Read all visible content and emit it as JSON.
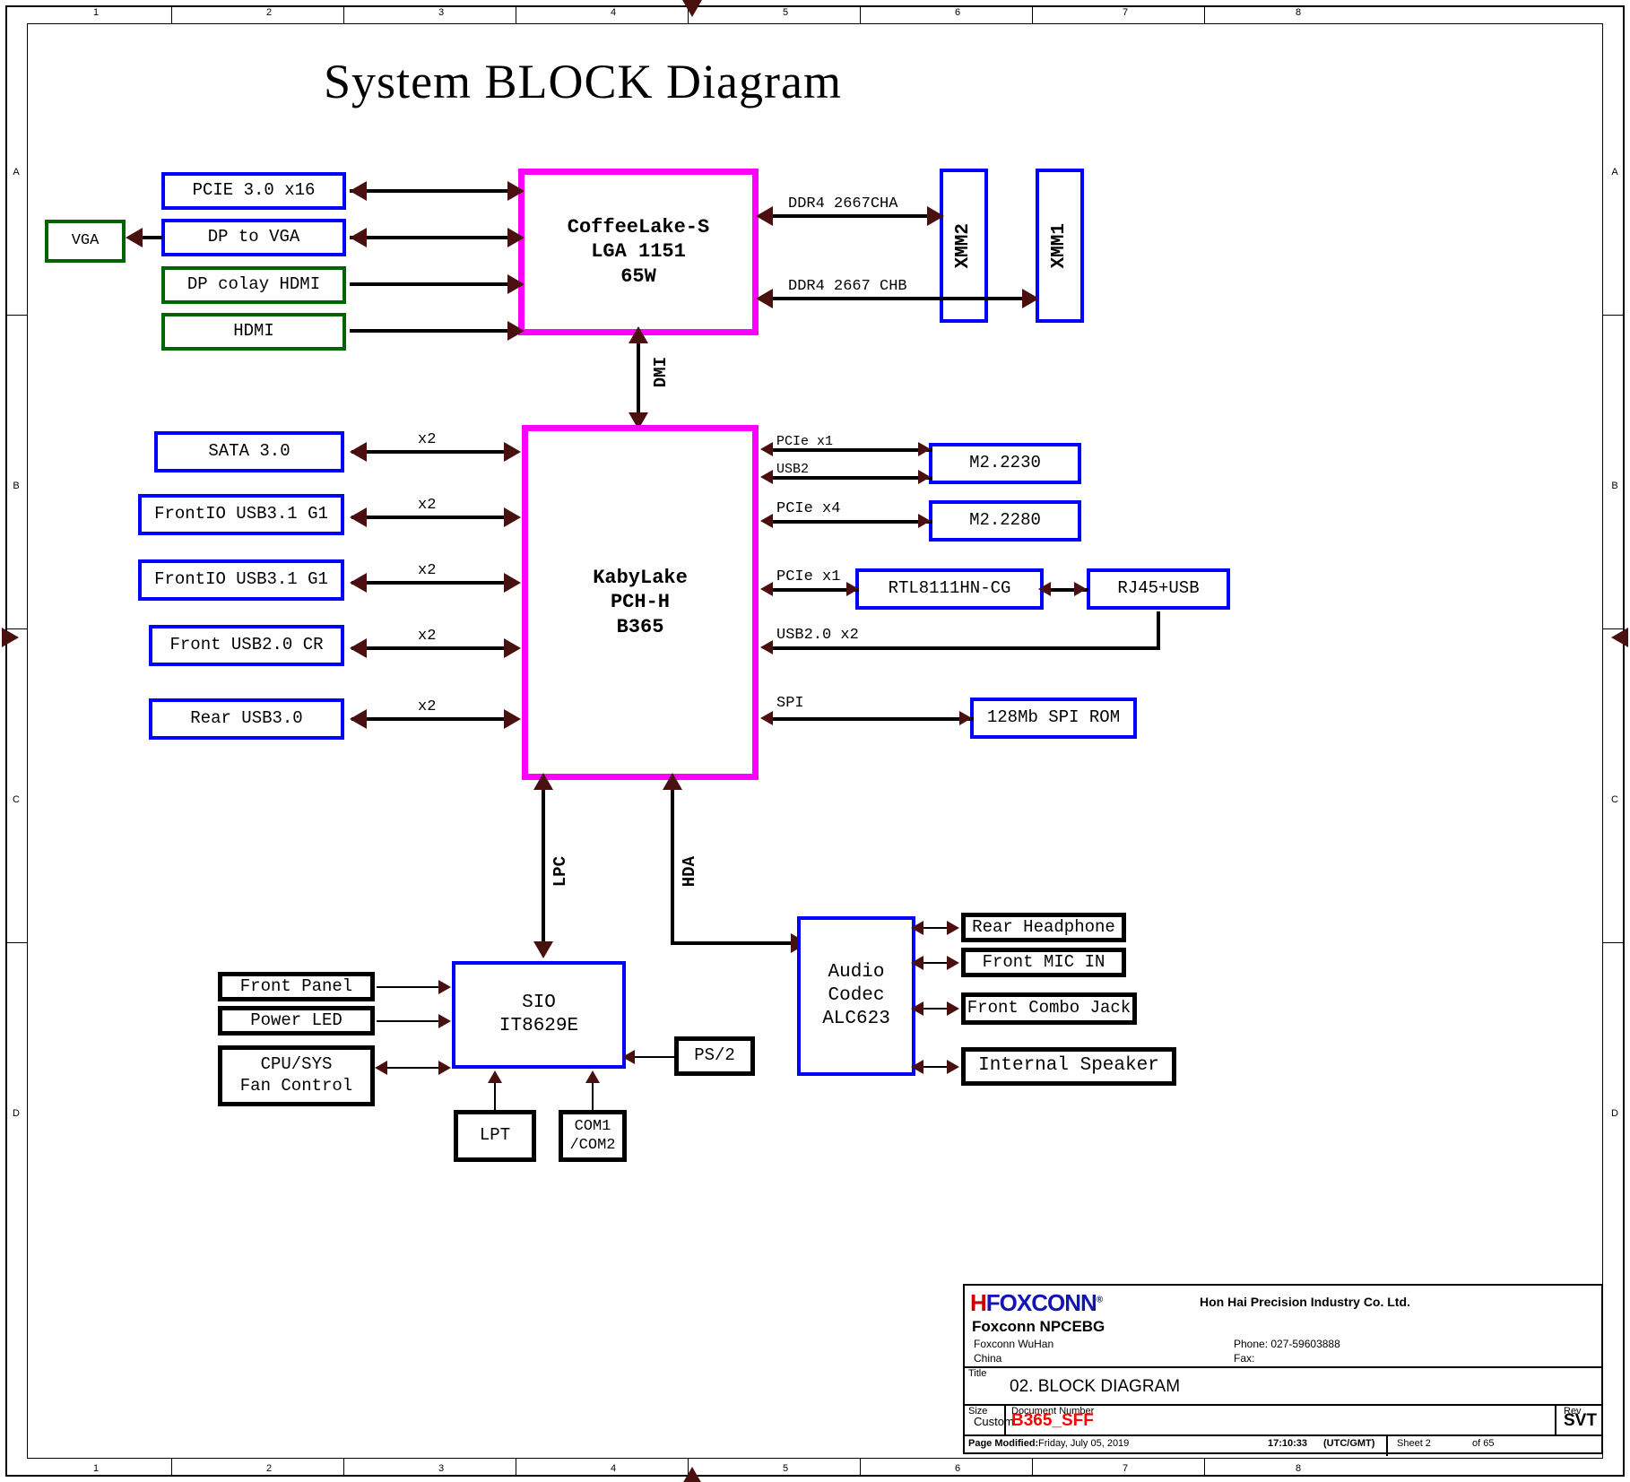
{
  "sheet": {
    "title": "System BLOCK Diagram",
    "zone_cols": [
      "1",
      "2",
      "3",
      "4",
      "5",
      "6",
      "7",
      "8"
    ],
    "zone_rows": [
      "A",
      "B",
      "C",
      "D"
    ]
  },
  "blocks": {
    "vga": {
      "label": "VGA"
    },
    "pcie_x16": {
      "label": "PCIE 3.0 x16"
    },
    "dp_to_vga": {
      "label": "DP to VGA"
    },
    "dp_colay_hdmi": {
      "label": "DP colay  HDMI"
    },
    "hdmi": {
      "label": "HDMI"
    },
    "cpu": {
      "label": "CoffeeLake-S\nLGA 1151\n65W"
    },
    "xmm2": {
      "label": "XMM2"
    },
    "xmm1": {
      "label": "XMM1"
    },
    "sata": {
      "label": "SATA 3.0"
    },
    "frontio_usb31_a": {
      "label": "FrontIO USB3.1 G1"
    },
    "frontio_usb31_b": {
      "label": "FrontIO USB3.1 G1"
    },
    "front_usb20_cr": {
      "label": "Front USB2.0 CR"
    },
    "rear_usb30": {
      "label": "Rear USB3.0"
    },
    "pch": {
      "label": "KabyLake\nPCH-H\nB365"
    },
    "m2_2230": {
      "label": "M2.2230"
    },
    "m2_2280": {
      "label": "M2.2280"
    },
    "rtl8111": {
      "label": "RTL8111HN-CG"
    },
    "rj45_usb": {
      "label": "RJ45+USB"
    },
    "spi_rom": {
      "label": "128Mb SPI ROM"
    },
    "front_panel": {
      "label": "Front Panel"
    },
    "power_led": {
      "label": "Power LED"
    },
    "fan_control": {
      "label": "CPU/SYS\nFan Control"
    },
    "sio": {
      "label": "SIO\nIT8629E"
    },
    "lpt": {
      "label": "LPT"
    },
    "com1_com2": {
      "label": "COM1\n/COM2"
    },
    "ps2": {
      "label": "PS/2"
    },
    "audio_codec": {
      "label": "Audio\nCodec\nALC623"
    },
    "rear_headphone": {
      "label": "Rear Headphone"
    },
    "front_mic_in": {
      "label": "Front MIC IN"
    },
    "front_combo": {
      "label": "Front Combo Jack"
    },
    "internal_spk": {
      "label": "Internal Speaker"
    }
  },
  "wire_labels": {
    "ddr4_cha": "DDR4 2667CHA",
    "ddr4_chb": "DDR4 2667 CHB",
    "dmi": "DMI",
    "sata_x2": "x2",
    "usb31a_x2": "x2",
    "usb31b_x2": "x2",
    "usb20_x2": "x2",
    "rear_x2": "x2",
    "pcie_x1_a": "PCIe x1",
    "usb2": "USB2",
    "pcie_x4": "PCIe x4",
    "pcie_x1_b": "PCIe x1",
    "usb20_2x": "USB2.0 x2",
    "spi": "SPI",
    "lpc": "LPC",
    "hda": "HDA"
  },
  "title_block": {
    "logo_h": "H",
    "logo_text": "FOXCONN",
    "logo_reg": "®",
    "company_unit": "Foxconn NPCEBG",
    "address_line1": "Foxconn WuHan",
    "address_line2": "China",
    "corporate_name": "Hon Hai Precision Industry Co. Ltd.",
    "phone": "Phone:  027-59603888",
    "fax": "Fax:",
    "title_label": "Title",
    "title_value": "02. BLOCK DIAGRAM",
    "size_label": "Size",
    "size_value": "Custom",
    "docnum_label": "Document Number",
    "docnum_value": "B365_SFF",
    "rev_label": "Rev",
    "rev_value": "SVT",
    "page_modified_label": "Page Modified:",
    "page_modified_value": "Friday, July 05, 2019",
    "time_value": "17:10:33",
    "timezone": "(UTC/GMT)",
    "sheet_label": "Sheet 2",
    "sheet_of": "of 65"
  },
  "colors": {
    "blue_border": "#0000ff",
    "green_border": "#006400",
    "magenta_border": "#ff00ff",
    "black_border": "#000000",
    "arrow": "#4a0f0f",
    "doc_red": "#ff0000",
    "logo_blue": "#1414b4"
  }
}
